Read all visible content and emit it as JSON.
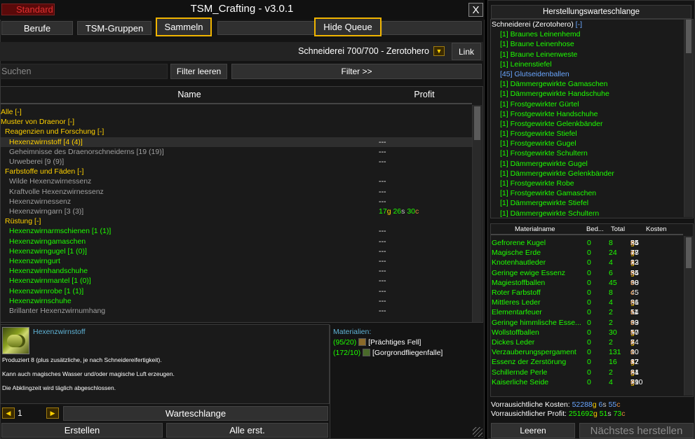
{
  "window": {
    "badge": "Standard",
    "title": "TSM_Crafting - v3.0.1",
    "close": "X"
  },
  "tabs": {
    "berufe": "Berufe",
    "groups": "TSM-Gruppen",
    "gather": "Sammeln",
    "hide_queue": "Hide Queue"
  },
  "profession": {
    "label": "Schneiderei 700/700 - Zerotohero",
    "link": "Link"
  },
  "search": {
    "placeholder": "Suchen",
    "clear": "Filter leeren",
    "filter": "Filter >>"
  },
  "table": {
    "col_name": "Name",
    "col_profit": "Profit"
  },
  "recipes": [
    {
      "text": "Alle [-]",
      "cls": "gold",
      "indent": 0,
      "profit": ""
    },
    {
      "text": "Muster von Draenor [-]",
      "cls": "gold",
      "indent": 0,
      "profit": ""
    },
    {
      "text": "Reagenzien und Forschung [-]",
      "cls": "gold",
      "indent": 1,
      "profit": ""
    },
    {
      "text": "Hexenzwirnstoff [4 (4)]",
      "cls": "gold",
      "indent": 2,
      "profit": "---",
      "selected": true
    },
    {
      "text": "Geheimnisse des Draenorschneiderns [19 (19)]",
      "cls": "grey",
      "indent": 2,
      "profit": "---"
    },
    {
      "text": "Urweberei [9 (9)]",
      "cls": "grey",
      "indent": 2,
      "profit": "---"
    },
    {
      "text": "Farbstoffe und Fäden [-]",
      "cls": "gold",
      "indent": 1,
      "profit": ""
    },
    {
      "text": "Wilde Hexenzwirnessenz",
      "cls": "grey",
      "indent": 2,
      "profit": "---"
    },
    {
      "text": "Kraftvolle Hexenzwirnessenz",
      "cls": "grey",
      "indent": 2,
      "profit": "---"
    },
    {
      "text": "Hexenzwirnessenz",
      "cls": "grey",
      "indent": 2,
      "profit": "---"
    },
    {
      "text": "Hexenzwirngarn [3 (3)]",
      "cls": "grey",
      "indent": 2,
      "profit": "",
      "money": {
        "g": "17",
        "s": "26",
        "c": "30"
      }
    },
    {
      "text": "Rüstung [-]",
      "cls": "gold",
      "indent": 1,
      "profit": ""
    },
    {
      "text": "Hexenzwirnarmschienen [1 (1)]",
      "cls": "green",
      "indent": 2,
      "profit": "---"
    },
    {
      "text": "Hexenzwirngamaschen",
      "cls": "green",
      "indent": 2,
      "profit": "---"
    },
    {
      "text": "Hexenzwirngugel [1 (0)]",
      "cls": "green",
      "indent": 2,
      "profit": "---"
    },
    {
      "text": "Hexenzwirngurt",
      "cls": "green",
      "indent": 2,
      "profit": "---"
    },
    {
      "text": "Hexenzwirnhandschuhe",
      "cls": "green",
      "indent": 2,
      "profit": "---"
    },
    {
      "text": "Hexenzwirnmantel [1 (0)]",
      "cls": "green",
      "indent": 2,
      "profit": "---"
    },
    {
      "text": "Hexenzwirnrobe [1 (1)]",
      "cls": "green",
      "indent": 2,
      "profit": "---"
    },
    {
      "text": "Hexenzwirnschuhe",
      "cls": "green",
      "indent": 2,
      "profit": "---"
    },
    {
      "text": "Brillanter Hexenzwirnumhang",
      "cls": "grey",
      "indent": 2,
      "profit": "---"
    }
  ],
  "detail": {
    "name": "Hexenzwirnstoff",
    "line1": "Produziert 8 (plus zusätzliche, je nach Schneidereifertigkeit).",
    "line2": "Kann auch magisches Wasser und/oder magische Luft erzeugen.",
    "line3": "Die Abklingzeit wird täglich abgeschlossen.",
    "materials_label": "Materialien:",
    "materials": [
      {
        "count": "(95/20)",
        "name": "[Prächtiges Fell]"
      },
      {
        "count": "(172/10)",
        "name": "[Gorgrondfliegenfalle]"
      }
    ]
  },
  "actions": {
    "quantity": "1",
    "queue": "Warteschlange",
    "create": "Erstellen",
    "create_all": "Alle erst."
  },
  "queue": {
    "title": "Herstellungswarteschlange",
    "header": "Schneiderei (Zerotohero)",
    "header_toggle": "[-]",
    "items": [
      {
        "text": "[1] Braunes Leinenhemd",
        "cls": "green"
      },
      {
        "text": "[1] Braune Leinenhose",
        "cls": "green"
      },
      {
        "text": "[1] Braune Leinenweste",
        "cls": "green"
      },
      {
        "text": "[1] Leinenstiefel",
        "cls": "green"
      },
      {
        "text": "[45] Glutseidenballen",
        "cls": "blue"
      },
      {
        "text": "[1] Dämmergewirkte Gamaschen",
        "cls": "green"
      },
      {
        "text": "[1] Dämmergewirkte Handschuhe",
        "cls": "green"
      },
      {
        "text": "[1] Frostgewirkter Gürtel",
        "cls": "green"
      },
      {
        "text": "[1] Frostgewirkte Handschuhe",
        "cls": "green"
      },
      {
        "text": "[1] Frostgewirkte Gelenkbänder",
        "cls": "green"
      },
      {
        "text": "[1] Frostgewirkte Stiefel",
        "cls": "green"
      },
      {
        "text": "[1] Frostgewirkte Gugel",
        "cls": "green"
      },
      {
        "text": "[1] Frostgewirkte Schultern",
        "cls": "green"
      },
      {
        "text": "[1] Dämmergewirkte Gugel",
        "cls": "green"
      },
      {
        "text": "[1] Dämmergewirkte Gelenkbänder",
        "cls": "green"
      },
      {
        "text": "[1] Frostgewirkte Robe",
        "cls": "green"
      },
      {
        "text": "[1] Frostgewirkte Gamaschen",
        "cls": "green"
      },
      {
        "text": "[1] Dämmergewirkte Stiefel",
        "cls": "green"
      },
      {
        "text": "[1] Dämmergewirkte Schultern",
        "cls": "green"
      }
    ]
  },
  "materials": {
    "col_name": "Materialname",
    "col_need": "Bed...",
    "col_total": "Total",
    "col_cost": "Kosten",
    "rows": [
      {
        "name": "Gefrorene Kugel",
        "need": "0",
        "total": "8",
        "g": "55",
        "s": "25",
        "c": "84"
      },
      {
        "name": "Magische Erde",
        "need": "0",
        "total": "24",
        "g": "7",
        "s": "47",
        "c": "78"
      },
      {
        "name": "Knotenhautleder",
        "need": "0",
        "total": "4",
        "g": "2",
        "s": "32",
        "c": "13"
      },
      {
        "name": "Geringe ewige Essenz",
        "need": "0",
        "total": "6",
        "g": "3",
        "s": "35",
        "c": "54"
      },
      {
        "name": "Magiestoffballen",
        "need": "0",
        "total": "45",
        "g": "",
        "s": "98",
        "c": "60"
      },
      {
        "name": "Roter Farbstoff",
        "need": "0",
        "total": "8",
        "g": "",
        "s": "",
        "c": "45"
      },
      {
        "name": "Mittleres Leder",
        "need": "0",
        "total": "4",
        "g": "3",
        "s": "36",
        "c": "81"
      },
      {
        "name": "Elementarfeuer",
        "need": "0",
        "total": "2",
        "g": "",
        "s": "11",
        "c": "54"
      },
      {
        "name": "Geringe himmlische Esse...",
        "need": "0",
        "total": "2",
        "g": "",
        "s": "63",
        "c": "99"
      },
      {
        "name": "Wollstoffballen",
        "need": "0",
        "total": "30",
        "g": "1",
        "s": "57",
        "c": "50"
      },
      {
        "name": "Dickes Leder",
        "need": "0",
        "total": "2",
        "g": "2",
        "s": "7",
        "c": "64"
      },
      {
        "name": "Verzauberungspergament",
        "need": "0",
        "total": "131",
        "g": "",
        "s": "10",
        "c": "0"
      },
      {
        "name": "Essenz der Zerstörung",
        "need": "0",
        "total": "16",
        "g": "1",
        "s": "82",
        "c": "47"
      },
      {
        "name": "Schillernde Perle",
        "need": "0",
        "total": "2",
        "g": "2",
        "s": "84",
        "c": "61"
      },
      {
        "name": "Kaiserliche Seide",
        "need": "0",
        "total": "4",
        "g": "310",
        "s": "6",
        "c": "79"
      }
    ],
    "est_cost_label": "Vorrausichtliche Kosten:",
    "est_cost": {
      "g": "52288",
      "s": "6",
      "c": "55"
    },
    "est_profit_label": "Vorrausichtlicher Profit:",
    "est_profit": {
      "g": "251692",
      "s": "51",
      "c": "73"
    }
  },
  "bottom": {
    "clear": "Leeren",
    "next": "Nächstes herstellen"
  }
}
